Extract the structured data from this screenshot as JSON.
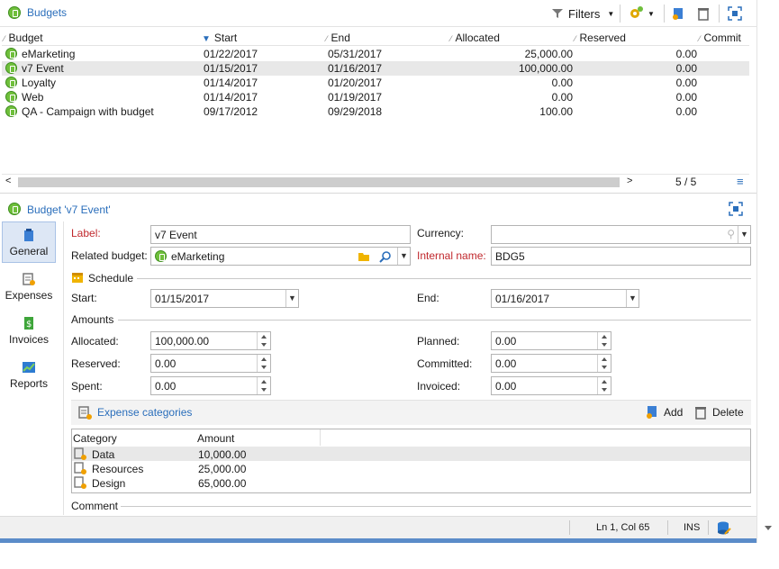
{
  "top": {
    "title": "Budgets",
    "filters_label": "Filters"
  },
  "grid": {
    "columns": [
      "Budget",
      "Start",
      "End",
      "Allocated",
      "Reserved",
      "Commit"
    ],
    "rows": [
      {
        "budget": "eMarketing",
        "start": "01/22/2017",
        "end": "05/31/2017",
        "allocated": "25,000.00",
        "reserved": "0.00"
      },
      {
        "budget": "v7 Event",
        "start": "01/15/2017",
        "end": "01/16/2017",
        "allocated": "100,000.00",
        "reserved": "0.00"
      },
      {
        "budget": "Loyalty",
        "start": "01/14/2017",
        "end": "01/20/2017",
        "allocated": "0.00",
        "reserved": "0.00"
      },
      {
        "budget": "Web",
        "start": "01/14/2017",
        "end": "01/19/2017",
        "allocated": "0.00",
        "reserved": "0.00"
      },
      {
        "budget": "QA - Campaign with budget",
        "start": "09/17/2012",
        "end": "09/29/2018",
        "allocated": "100.00",
        "reserved": "0.00"
      }
    ],
    "count": "5 / 5"
  },
  "detail": {
    "title": "Budget 'v7 Event'",
    "sidebar": [
      "General",
      "Expenses",
      "Invoices",
      "Reports"
    ],
    "label_label": "Label:",
    "label_value": "v7 Event",
    "currency_label": "Currency:",
    "currency_value": "",
    "related_label": "Related budget:",
    "related_value": "eMarketing",
    "internal_label": "Internal name:",
    "internal_value": "BDG5",
    "schedule_label": "Schedule",
    "start_label": "Start:",
    "start_value": "01/15/2017",
    "end_label": "End:",
    "end_value": "01/16/2017",
    "amounts_label": "Amounts",
    "allocated_label": "Allocated:",
    "allocated_value": "100,000.00",
    "planned_label": "Planned:",
    "planned_value": "0.00",
    "reserved_label": "Reserved:",
    "reserved_value": "0.00",
    "committed_label": "Committed:",
    "committed_value": "0.00",
    "spent_label": "Spent:",
    "spent_value": "0.00",
    "invoiced_label": "Invoiced:",
    "invoiced_value": "0.00",
    "expense_categories_label": "Expense categories",
    "add_label": "Add",
    "delete_label": "Delete",
    "cat_columns": [
      "Category",
      "Amount"
    ],
    "categories": [
      {
        "name": "Data",
        "amount": "10,000.00"
      },
      {
        "name": "Resources",
        "amount": "25,000.00"
      },
      {
        "name": "Design",
        "amount": "65,000.00"
      }
    ],
    "comment_label": "Comment"
  },
  "status": {
    "position": "Ln 1, Col 65",
    "mode": "INS"
  },
  "colors": {
    "accent": "#2a6ebb",
    "required": "#c0282d",
    "selection": "#e8e8e8"
  }
}
